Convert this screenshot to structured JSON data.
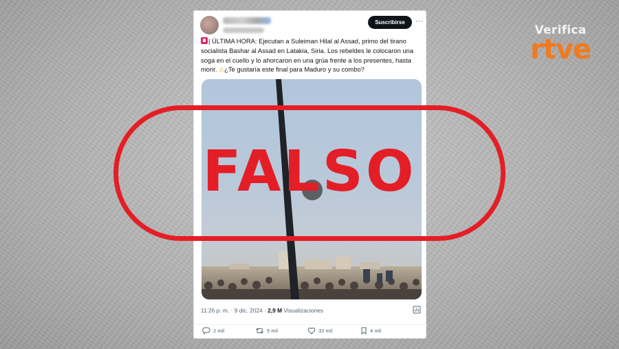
{
  "watermark": {
    "top": "Verifica",
    "brand": "rtve"
  },
  "tweet": {
    "subscribe_label": "Suscribirse",
    "more_label": "···",
    "text_line1": "| ÚLTIMA HORA: Ejecutan a Suleiman Hilal al Assad, primo del tirano socialista Bashar al Assad en Latakia, Siria. Los rebeldes le colocaron una soga en el cuello y lo ahorcaron en una grúa frente a los presentes, hasta morir. ",
    "text_line2": "¿Te gustaría este final para Maduro y su combo?",
    "timestamp": "11:26 p. m. · 9 dic. 2024 · ",
    "views_count": "2,9 M",
    "views_label": " Visualizaciones",
    "actions": {
      "replies": "2 mil",
      "reposts": "5 mil",
      "likes": "32 mil",
      "bookmarks": "4 mil"
    }
  },
  "stamp": {
    "label": "FALSO",
    "color": "#e41e26"
  },
  "colors": {
    "brand_orange": "#f07a1e",
    "button_dark": "#0f1419"
  },
  "icons": [
    "siren-icon",
    "warning-icon",
    "play-icon",
    "reply-icon",
    "repost-icon",
    "like-icon",
    "bookmark-icon",
    "views-chart-icon",
    "more-icon"
  ]
}
